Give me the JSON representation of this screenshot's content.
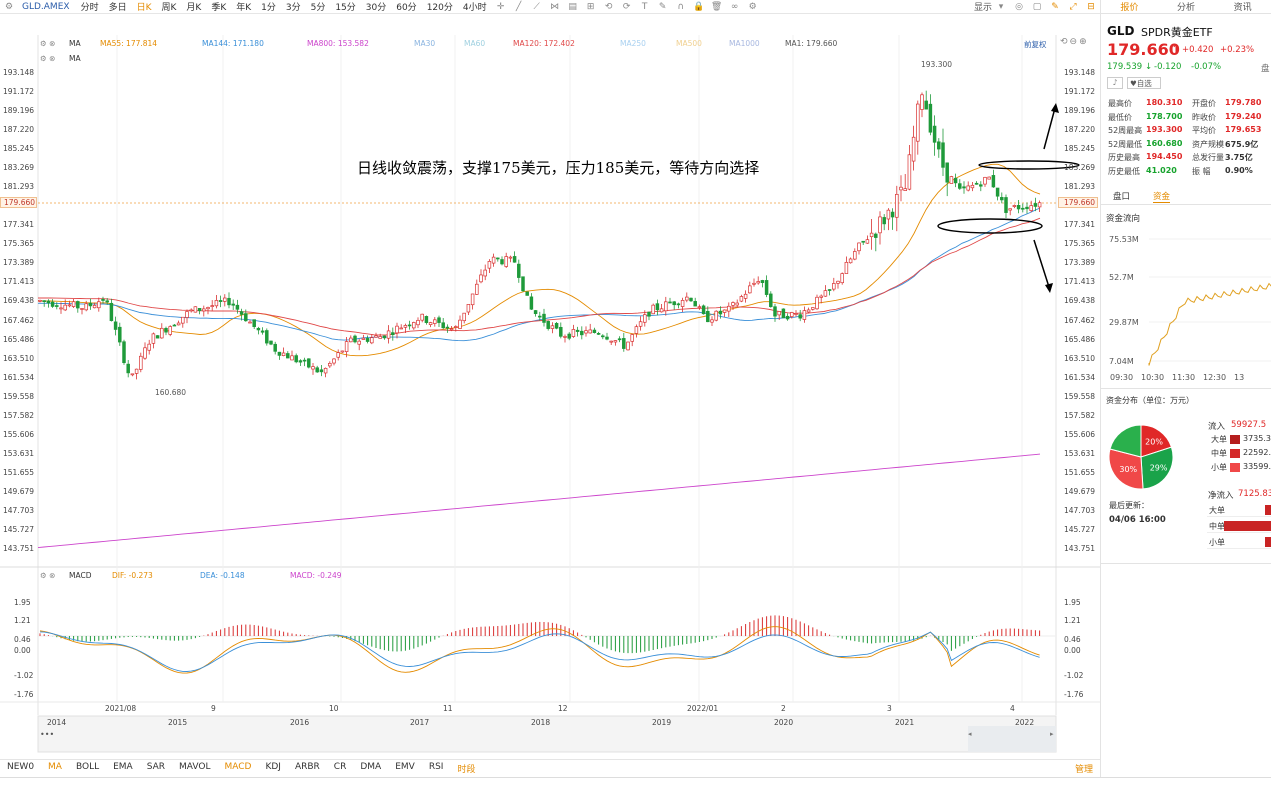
{
  "toolbar": {
    "symbol": "GLD.AMEX",
    "periods": [
      "分时",
      "多日",
      "日K",
      "周K",
      "月K",
      "季K",
      "年K",
      "1分",
      "3分",
      "5分",
      "15分",
      "30分",
      "60分",
      "120分",
      "4小时"
    ],
    "active_period": "日K",
    "display_label": "显示"
  },
  "ma_legend": {
    "ma_label": "MA",
    "ma55": "MA55: 177.814",
    "ma144": "MA144: 171.180",
    "ma800": "MA800: 153.582",
    "ma30": "MA30",
    "ma60": "MA60",
    "ma120": "MA120: 172.402",
    "ma250": "MA250",
    "ma500": "MA500",
    "ma1000": "MA1000",
    "ma1": "MA1: 179.660",
    "fq": "前复权",
    "ma2_label": "MA"
  },
  "price_axis": [
    "193.148",
    "191.172",
    "189.196",
    "187.220",
    "185.245",
    "183.269",
    "181.293",
    "179.660",
    "177.341",
    "175.365",
    "173.389",
    "171.413",
    "169.438",
    "167.462",
    "165.486",
    "163.510",
    "161.534",
    "159.558",
    "157.582",
    "155.606",
    "153.631",
    "151.655",
    "149.679",
    "147.703",
    "145.727",
    "143.751"
  ],
  "current_price_tag": "179.660",
  "annotations": {
    "main_text": "日线收敛震荡，支撑175美元，压力185美元，等待方向选择",
    "high_label": "193.300",
    "low_label": "160.680"
  },
  "macd": {
    "label": "MACD",
    "dif": "DIF: -0.273",
    "dea": "DEA: -0.148",
    "macd": "MACD: -0.249",
    "axis": [
      "1.95",
      "1.21",
      "0.46",
      "0.00",
      "-1.02",
      "-1.76"
    ]
  },
  "date_axis": {
    "ticks": [
      "2021/08",
      "9",
      "10",
      "11",
      "12",
      "2022/01",
      "2",
      "3",
      "4"
    ],
    "years": [
      "2014",
      "2015",
      "2016",
      "2017",
      "2018",
      "2019",
      "2020",
      "2021",
      "2022"
    ]
  },
  "indicator_tabs": [
    "NEW0",
    "MA",
    "BOLL",
    "EMA",
    "SAR",
    "MAVOL",
    "MACD",
    "KDJ",
    "ARBR",
    "CR",
    "DMA",
    "EMV",
    "RSI",
    "时段"
  ],
  "indicator_manage": "管理",
  "panel": {
    "tabs": [
      "报价",
      "分析",
      "资讯"
    ],
    "code": "GLD",
    "name": "SPDR黄金ETF",
    "price": "179.660",
    "change": "+0.420",
    "change_pct": "+0.23%",
    "after_price": "179.539",
    "after_change": "-0.120",
    "after_pct": "-0.07%",
    "tag": "自选",
    "quote_left": [
      {
        "k": "最高价",
        "v": "180.310"
      },
      {
        "k": "最低价",
        "v": "178.700"
      },
      {
        "k": "52周最高",
        "v": "193.300"
      },
      {
        "k": "52周最低",
        "v": "160.680"
      },
      {
        "k": "历史最高",
        "v": "194.450"
      },
      {
        "k": "历史最低",
        "v": "41.020"
      }
    ],
    "quote_right": [
      {
        "k": "开盘价",
        "v": "179.780"
      },
      {
        "k": "昨收价",
        "v": "179.240"
      },
      {
        "k": "平均价",
        "v": "179.653"
      },
      {
        "k": "资产规模",
        "v": "675.9亿"
      },
      {
        "k": "总发行量",
        "v": "3.75亿"
      },
      {
        "k": "振  幅",
        "v": "0.90%"
      }
    ],
    "subtabs": [
      "盘口",
      "资金"
    ],
    "flow_title": "资金流向",
    "flow_axis": [
      "75.53M",
      "52.7M",
      "29.87M",
      "7.04M"
    ],
    "flow_times": [
      "09:30",
      "10:30",
      "11:30",
      "12:30",
      "13"
    ],
    "dist_title": "资金分布（单位：万元）",
    "pie": [
      {
        "label": "20%",
        "value": 20,
        "color": "#e02828"
      },
      {
        "label": "29%",
        "value": 29,
        "color": "#1aa34a"
      },
      {
        "label": "30%",
        "value": 30,
        "color": "#f04848"
      },
      {
        "label": "",
        "value": 21,
        "color": "#2ab04c"
      }
    ],
    "inflow_label": "流入",
    "inflow_total": "59927.5",
    "inflow_rows": [
      {
        "k": "大单",
        "v": "3735.37",
        "color": "#b51e1e"
      },
      {
        "k": "中单",
        "v": "22592.6",
        "color": "#d42828"
      },
      {
        "k": "小单",
        "v": "33599.52",
        "color": "#f04848"
      }
    ],
    "last_update_label": "最后更新：",
    "last_update": "04/06 16:00",
    "net_label": "净流入",
    "net_total": "7125.83",
    "net_rows": [
      {
        "k": "大单",
        "v": 0.15
      },
      {
        "k": "中单",
        "v": 1.0
      },
      {
        "k": "小单",
        "v": 0.15
      }
    ]
  },
  "chart_data": {
    "type": "candlestick",
    "ylim": [
      143.751,
      193.148
    ],
    "resistance": 183.3,
    "support": 177.3,
    "ma800_range": [
      143.9,
      153.6
    ]
  }
}
